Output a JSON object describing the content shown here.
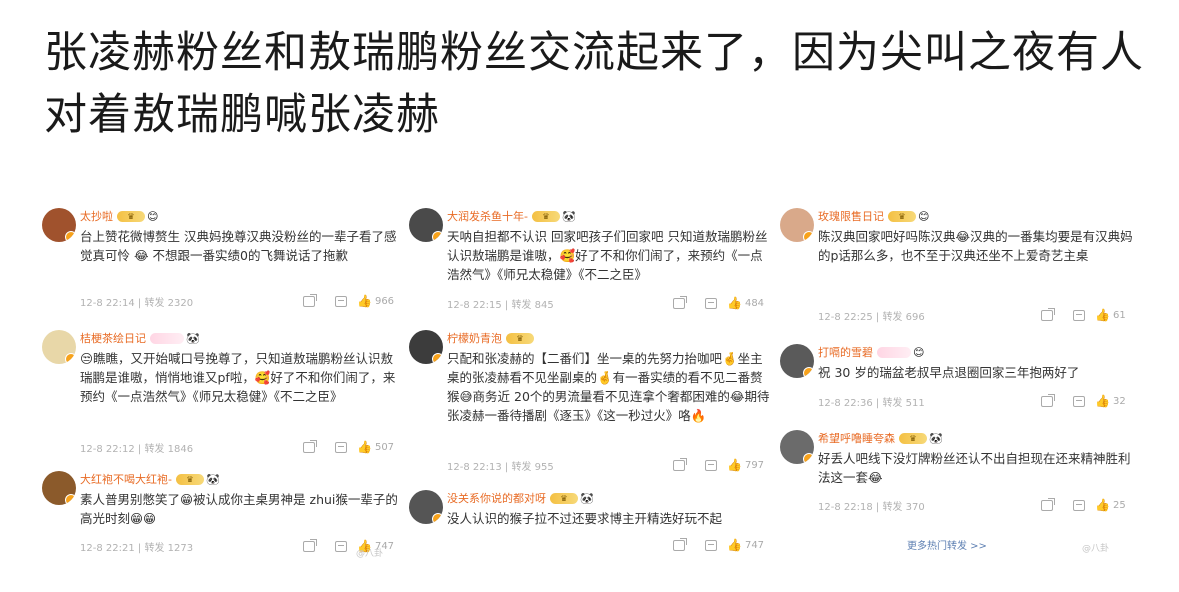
{
  "headline": "张凌赫粉丝和敖瑞鹏粉丝交流起来了，因为尖叫之夜有人对着敖瑞鹏喊张凌赫",
  "panels": [
    {
      "comments": [
        {
          "user": "太抄啦",
          "text": "台上赞花微博赘生 汉典妈挽尊汉典没粉丝的一辈子看了感觉真可怜 😂 不想跟一番实绩0的飞舞说话了拖歉",
          "date": "12-8 22:14",
          "repost": "转发 2320",
          "likes": "966",
          "avatar_color": "#a0522d"
        },
        {
          "user": "桔梗茶绘日记",
          "text": "😒瞧瞧，又开始喊口号挽尊了，只知道敖瑞鹏粉丝认识敖瑞鹏是谁嗷，悄悄地谁又pf啦，🥰好了不和你们闹了，来预约《一点浩然气》《师兄太稳健》《不二之臣》",
          "date": "12-8 22:12",
          "repost": "转发 1846",
          "likes": "507",
          "avatar_color": "#e8d7a8"
        },
        {
          "user": "大红袍不喝大红袍-",
          "text": "素人普男别憋笑了😁被认成你主桌男神是 zhui猴一辈子的高光时刻😁😁",
          "date": "12-8 22:21",
          "repost": "转发 1273",
          "likes": "747",
          "avatar_color": "#8b5a2b"
        }
      ]
    },
    {
      "comments": [
        {
          "user": "大润发杀鱼十年-",
          "text": "天呐自担都不认识 回家吧孩子们回家吧 只知道敖瑞鹏粉丝认识敖瑞鹏是谁嗷，🥰好了不和你们闹了，来预约《一点浩然气》《师兄太稳健》《不二之臣》",
          "date": "12-8 22:15",
          "repost": "转发 845",
          "likes": "484",
          "avatar_color": "#4a4a4a"
        },
        {
          "user": "柠檬奶青泡",
          "text": "只配和张凌赫的【二番们】坐一桌的先努力抬咖吧🤞坐主桌的张凌赫看不见坐副桌的🤞有一番实绩的看不见二番赘猴😅商务近 20个的男流量看不见连拿个奢都困难的😂期待张凌赫一番待播剧《逐玉》《这一秒过火》咯🔥",
          "date": "12-8 22:13",
          "repost": "转发 955",
          "likes": "797",
          "avatar_color": "#3c3c3c"
        },
        {
          "user": "没关系你说的都对呀",
          "text": "没人认识的猴子拉不过还要求博主开精选好玩不起",
          "date": "",
          "repost": "",
          "likes": "747",
          "avatar_color": "#555555"
        }
      ]
    },
    {
      "comments": [
        {
          "user": "玫瑰限售日记",
          "text": "陈汉典回家吧好吗陈汉典😂汉典的一番集均要是有汉典妈的p话那么多，也不至于汉典还坐不上爱奇艺主桌",
          "date": "12-8 22:25",
          "repost": "转发 696",
          "likes": "61",
          "avatar_color": "#d9a98a"
        },
        {
          "user": "打嗝的雪碧",
          "text": "祝 30 岁的瑞盆老叔早点退圈回家三年抱两好了",
          "date": "12-8 22:36",
          "repost": "转发 511",
          "likes": "32",
          "avatar_color": "#5a5a5a"
        },
        {
          "user": "希望呼噜睡夸森",
          "text": "好丢人吧线下没灯牌粉丝还认不出自担现在还来精神胜利法这一套😂",
          "date": "12-8 22:18",
          "repost": "转发 370",
          "likes": "25",
          "avatar_color": "#6b6b6b"
        }
      ],
      "more_hot": "更多热门转发 >>"
    }
  ],
  "icons": [
    "share-icon",
    "comment-icon",
    "like-icon",
    "verified-icon",
    "crown-badge-icon"
  ],
  "colors": {
    "username": "#e86b25",
    "meta": "#b2b2b2",
    "link": "#5d7fb2"
  },
  "watermark": "@八卦"
}
